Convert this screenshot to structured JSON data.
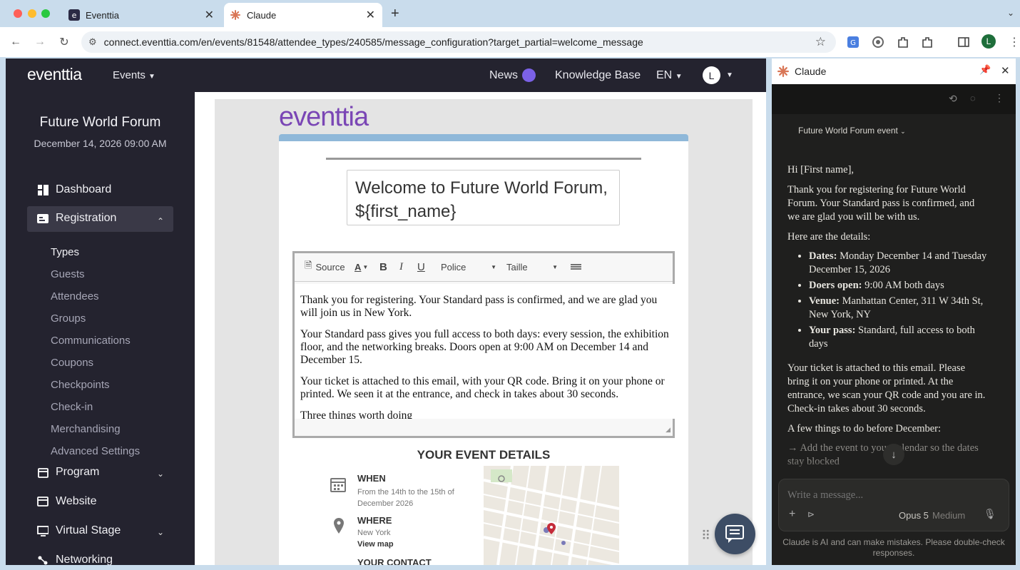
{
  "browser": {
    "tabs": [
      {
        "label": "Eventtia"
      },
      {
        "label": "Claude"
      }
    ],
    "url": "connect.eventtia.com/en/events/81548/attendee_types/240585/message_configuration?target_partial=welcome_message",
    "profile_initial": "L"
  },
  "topnav": {
    "logo": "eventtia",
    "events": "Events",
    "news": "News",
    "knowledge_base": "Knowledge Base",
    "lang": "EN",
    "user_initial": "L"
  },
  "event": {
    "name": "Future World Forum",
    "date": "December 14, 2026 09:00 AM"
  },
  "sidebar": {
    "dashboard": "Dashboard",
    "registration": "Registration",
    "sub_items": [
      "Types",
      "Guests",
      "Attendees",
      "Groups",
      "Communications",
      "Coupons",
      "Checkpoints",
      "Check-in",
      "Merchandising",
      "Advanced Settings"
    ],
    "program": "Program",
    "website": "Website",
    "virtual_stage": "Virtual Stage",
    "networking": "Networking"
  },
  "email": {
    "logo": "eventtia",
    "subject": "Welcome to Future World Forum, ${first_name}",
    "toolbar": {
      "source": "Source",
      "font": "Police",
      "size": "Taille"
    },
    "body": [
      "Thank you for registering. Your Standard pass is confirmed, and we are glad you will join us in New York.",
      "Your Standard pass gives you full access to both days: every session, the exhibition floor, and the networking breaks. Doors open at 9:00 AM on December 14 and December 15.",
      "Your ticket is attached to this email, with your QR code. Bring it on your phone or printed. We seen it at the entrance, and check in takes about 30 seconds.",
      "Three things worth doing"
    ],
    "details_title": "YOUR EVENT DETAILS",
    "when_label": "WHEN",
    "when_value": "From the 14th to the 15th of December 2026",
    "where_label": "WHERE",
    "where_value": "New York",
    "view_map": "View map",
    "contact_label": "YOUR CONTACT"
  },
  "claude": {
    "title": "Claude",
    "context": "Future World Forum event",
    "greeting": "Hi [First name],",
    "p1": "Thank you for registering for Future World Forum. Your Standard pass is confirmed, and we are glad you will be with us.",
    "p2": "Here are the details:",
    "bullets": [
      {
        "label": "Dates:",
        "text": "Monday December 14 and Tuesday December 15, 2026"
      },
      {
        "label": "Doers open:",
        "text": "9:00 AM both days"
      },
      {
        "label": "Venue:",
        "text": "Manhattan Center, 311 W 34th St, New York, NY"
      },
      {
        "label": "Your pass:",
        "text": "Standard, full access to both days"
      }
    ],
    "p3": "Your ticket is attached to this email. Please bring it on your phone or printed. At the entrance, we scan your QR code and you are in. Check-in takes about 30 seconds.",
    "p4": "A few things to do before December:",
    "p5": "→ Add the event to your calendar so the dates stay blocked",
    "input_placeholder": "Write a message...",
    "model": "Opus 5",
    "effort": "Medium",
    "disclaimer": "Claude is AI and can make mistakes. Please double-check responses."
  },
  "colors": {
    "sidebar_bg": "#24232f",
    "brand_purple": "#7a46b5",
    "header_blue": "#8fb8d9",
    "claude_orange": "#d97757"
  }
}
